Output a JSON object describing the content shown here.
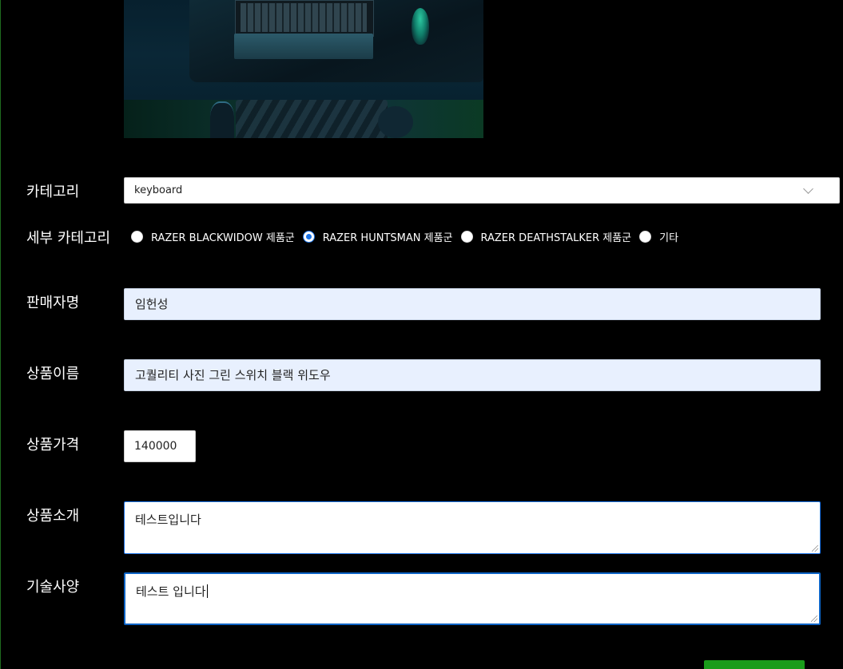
{
  "form": {
    "category_label": "카테고리",
    "category_value": "keyboard",
    "subcategory_label": "세부 카테고리",
    "subcategory_options": [
      {
        "label": "RAZER BLACKWIDOW 제품군",
        "checked": false
      },
      {
        "label": "RAZER HUNTSMAN 제품군",
        "checked": true
      },
      {
        "label": "RAZER DEATHSTALKER 제품군",
        "checked": false
      },
      {
        "label": "기타",
        "checked": false
      }
    ],
    "seller_label": "판매자명",
    "seller_value": "임헌성",
    "name_label": "상품이름",
    "name_value": "고퀄리티 사진 그린 스위치 블랙 위도우",
    "price_label": "상품가격",
    "price_value": "140000",
    "intro_label": "상품소개",
    "intro_value": "테스트입니다",
    "spec_label": "기술사양",
    "spec_value": "테스트 입니다"
  },
  "colors": {
    "background": "#000000",
    "accent": "#1a9c1a",
    "focus": "#1a73e8",
    "autofill": "#e8f0fe"
  }
}
